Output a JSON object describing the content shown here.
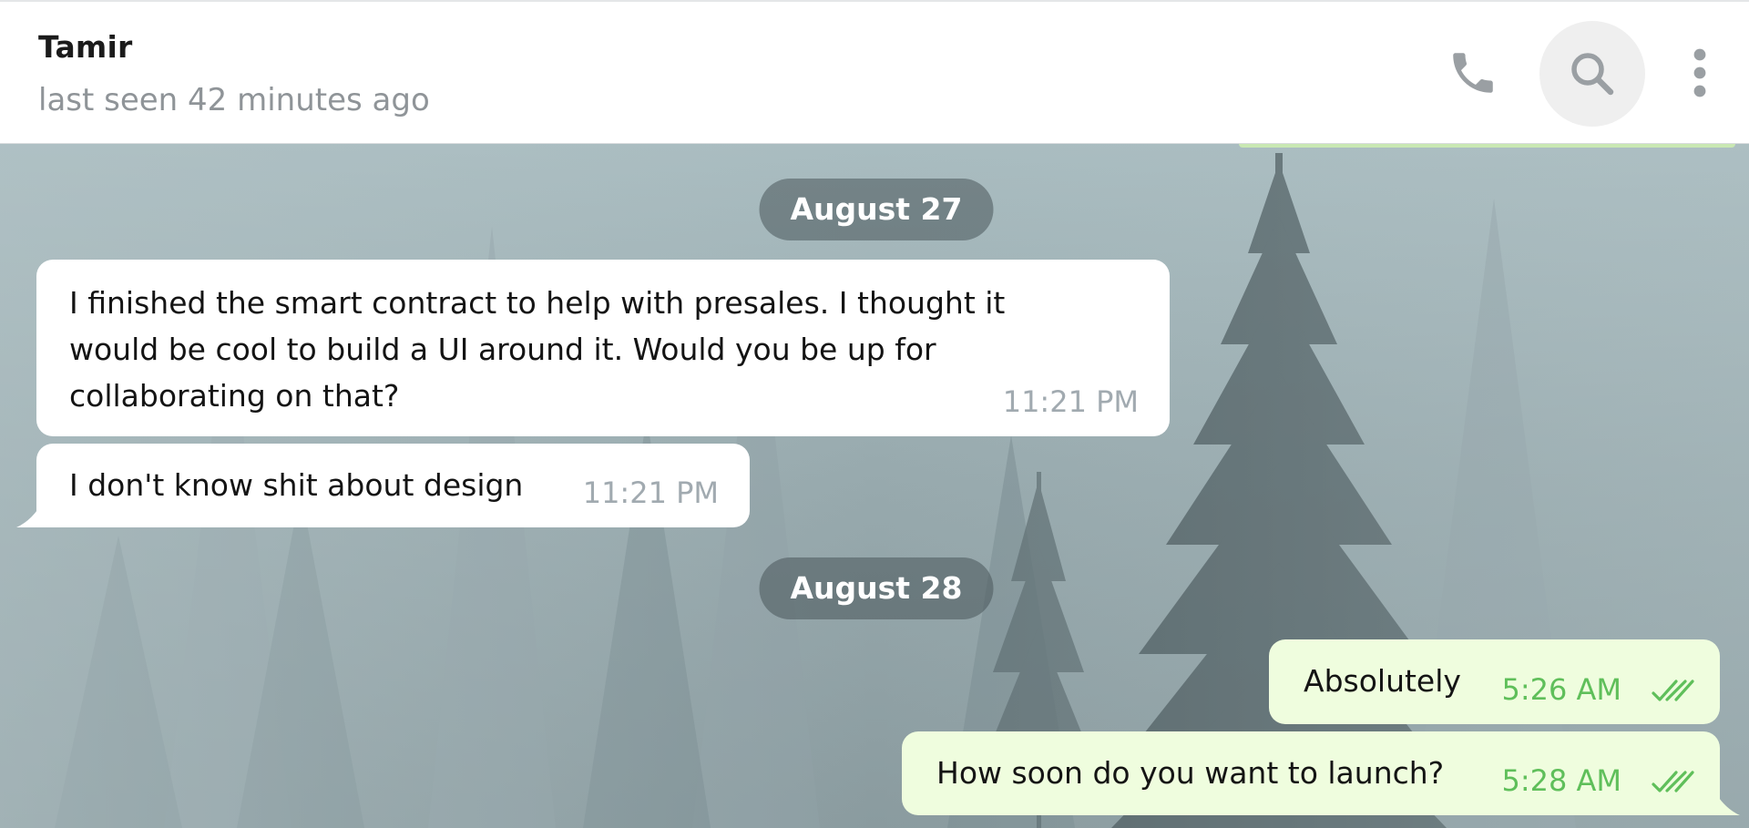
{
  "header": {
    "contact_name": "Tamir",
    "status": "last seen 42 minutes ago",
    "icons": [
      "phone-icon",
      "search-icon",
      "more-vertical-icon"
    ]
  },
  "dates": [
    "August 27",
    "August 28"
  ],
  "messages": [
    {
      "direction": "incoming",
      "text": "I finished the smart contract to help with presales. I thought it would be cool to build a UI around it. Would you be up for collaborating on that?",
      "time": "11:21 PM"
    },
    {
      "direction": "incoming",
      "text": "I don't know shit about design",
      "time": "11:21 PM"
    },
    {
      "direction": "outgoing",
      "text": "Absolutely",
      "time": "5:26 AM",
      "status_icon": "double-check-icon"
    },
    {
      "direction": "outgoing",
      "text": "How soon do you want to launch?",
      "time": "5:28 AM",
      "status_icon": "double-check-icon"
    }
  ],
  "colors": {
    "incoming_bubble": "#ffffff",
    "outgoing_bubble": "#effdde",
    "outgoing_time": "#5fbf5a",
    "incoming_time": "#a1aab0",
    "date_pill": "#48555a"
  }
}
